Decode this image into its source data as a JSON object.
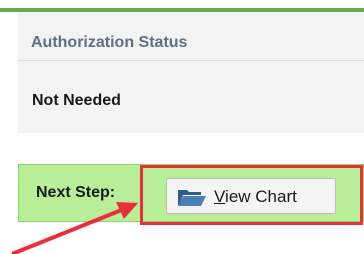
{
  "authorization": {
    "header_label": "Authorization Status",
    "status_value": "Not Needed"
  },
  "next_step": {
    "label": "Next Step:",
    "view_chart_button": {
      "label": "View Chart",
      "icon": "folder-open-icon"
    }
  },
  "colors": {
    "accent_bar": "#6aa84f",
    "next_step_background": "#b9ee98",
    "highlight_annotation": "#e8303c"
  }
}
